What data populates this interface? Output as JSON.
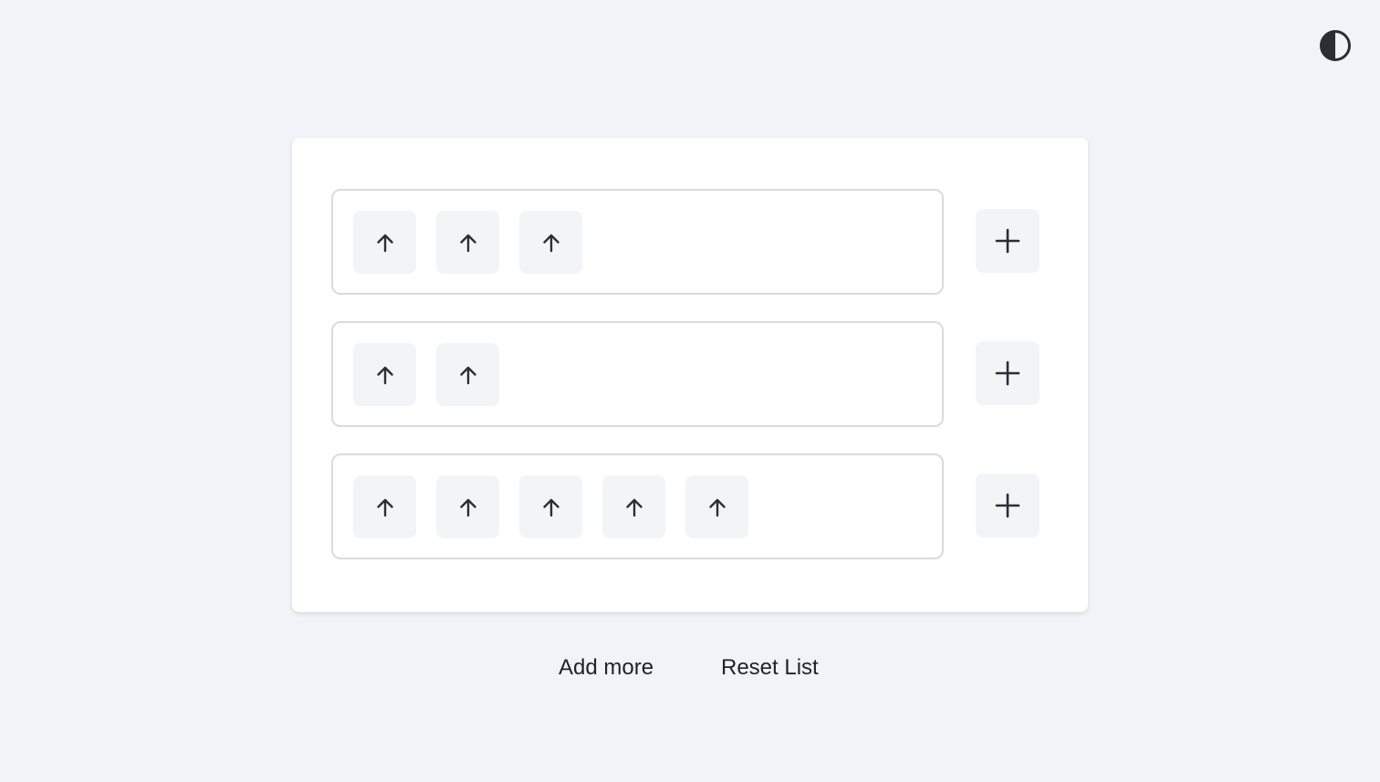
{
  "theme_toggle": {
    "icon": "contrast-icon"
  },
  "rows": [
    {
      "item_count": 3,
      "item_icon": "arrow-up-icon",
      "add_icon": "plus-icon"
    },
    {
      "item_count": 2,
      "item_icon": "arrow-up-icon",
      "add_icon": "plus-icon"
    },
    {
      "item_count": 5,
      "item_icon": "arrow-up-icon",
      "add_icon": "plus-icon"
    }
  ],
  "actions": {
    "add_more_label": "Add more",
    "reset_label": "Reset List"
  },
  "colors": {
    "background": "#f0f4f8",
    "card": "#ffffff",
    "chip": "#f3f4f6",
    "lane_border": "#d9dbdf",
    "icon": "#2b2f33",
    "text": "#1f2328"
  }
}
